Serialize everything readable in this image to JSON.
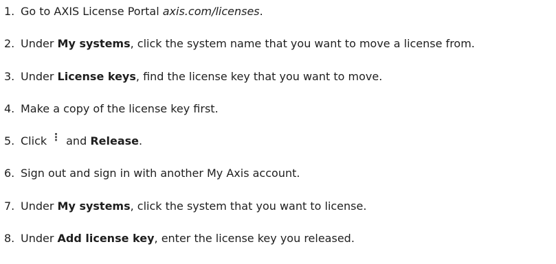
{
  "steps": [
    {
      "number": "1.",
      "text_1": "Go to AXIS License Portal ",
      "link": "axis.com/licenses",
      "text_2": "."
    },
    {
      "number": "2.",
      "text_1": "Under ",
      "bold": "My systems",
      "text_2": ", click the system name that you want to move a license from."
    },
    {
      "number": "3.",
      "text_1": "Under ",
      "bold": "License keys",
      "text_2": ", find the license key that you want to move."
    },
    {
      "number": "4.",
      "text": "Make a copy of the license key first."
    },
    {
      "number": "5.",
      "text_1": "Click",
      "icon": "more-options-vertical-icon",
      "text_2": "and ",
      "bold": "Release",
      "text_3": "."
    },
    {
      "number": "6.",
      "text": "Sign out and sign in with another My Axis account."
    },
    {
      "number": "7.",
      "text_1": "Under ",
      "bold": "My systems",
      "text_2": ", click the system that you want to license."
    },
    {
      "number": "8.",
      "text_1": "Under ",
      "bold": "Add license key",
      "text_2": ", enter the license key you released."
    }
  ]
}
